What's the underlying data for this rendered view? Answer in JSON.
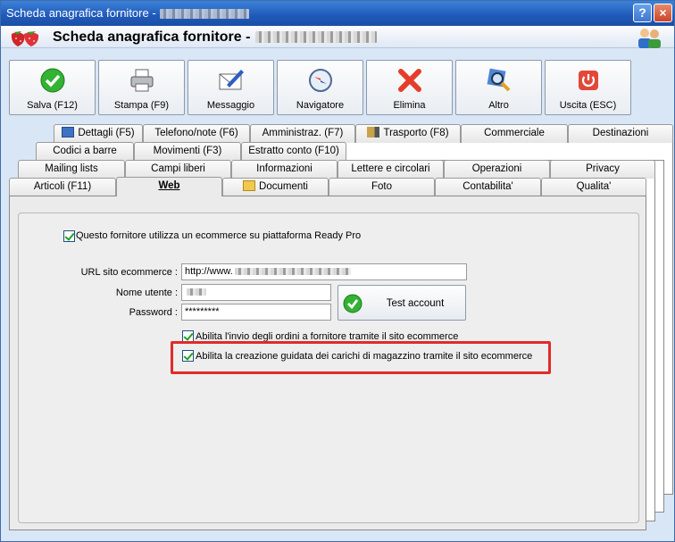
{
  "window": {
    "title": "Scheda anagrafica fornitore -"
  },
  "header": {
    "title": "Scheda anagrafica fornitore -"
  },
  "toolbar": {
    "buttons": [
      {
        "label": "Salva (F12)"
      },
      {
        "label": "Stampa (F9)"
      },
      {
        "label": "Messaggio"
      },
      {
        "label": "Navigatore"
      },
      {
        "label": "Elimina"
      },
      {
        "label": "Altro"
      },
      {
        "label": "Uscita (ESC)"
      }
    ]
  },
  "tabs": {
    "row1": [
      "Dettagli (F5)",
      "Telefono/note (F6)",
      "Amministraz. (F7)",
      "Trasporto (F8)",
      "Commerciale",
      "Destinazioni"
    ],
    "row2": [
      "Codici a barre",
      "Movimenti (F3)",
      "Estratto conto (F10)"
    ],
    "row3": [
      "Mailing lists",
      "Campi liberi",
      "Informazioni",
      "Lettere e circolari",
      "Operazioni",
      "Privacy"
    ],
    "row4": [
      "Articoli (F11)",
      "Web",
      "Documenti",
      "Foto",
      "Contabilita'",
      "Qualita'"
    ]
  },
  "web": {
    "ecommerce_checkbox": "Questo fornitore utilizza un ecommerce su piattaforma Ready Pro",
    "url_label": "URL sito ecommerce :",
    "url_value": "http://www.",
    "user_label": "Nome utente :",
    "password_label": "Password :",
    "password_value": "*********",
    "test_button": "Test account",
    "orders_checkbox": "Abilita l'invio degli ordini a fornitore tramite il sito ecommerce",
    "loads_checkbox": "Abilita la creazione guidata dei carichi di magazzino tramite il sito ecommerce"
  },
  "colors": {
    "titlebar": "#2059b9",
    "window_bg": "#d9e6f5",
    "highlight": "#e22a2a",
    "check": "#21a121"
  }
}
